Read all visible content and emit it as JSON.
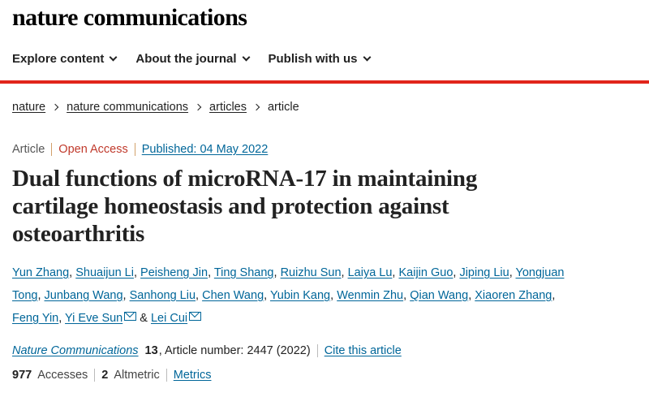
{
  "site": {
    "logo": "nature communications"
  },
  "nav": {
    "items": [
      {
        "label": "Explore content"
      },
      {
        "label": "About the journal"
      },
      {
        "label": "Publish with us"
      }
    ]
  },
  "breadcrumb": {
    "items": [
      "nature",
      "nature communications",
      "articles"
    ],
    "current": "article"
  },
  "meta": {
    "type": "Article",
    "access": "Open Access",
    "published": "Published: 04 May 2022"
  },
  "article": {
    "title": "Dual functions of microRNA-17 in maintaining cartilage homeostasis and protection against osteoarthritis",
    "authors": [
      "Yun Zhang",
      "Shuaijun Li",
      "Peisheng Jin",
      "Ting Shang",
      "Ruizhu Sun",
      "Laiya Lu",
      "Kaijin Guo",
      "Jiping Liu",
      "Yongjuan Tong",
      "Junbang Wang",
      "Sanhong Liu",
      "Chen Wang",
      "Yubin Kang",
      "Wenmin Zhu",
      "Qian Wang",
      "Xiaoren Zhang",
      "Feng Yin",
      "Yi Eve Sun",
      "Lei Cui"
    ],
    "author_joiner": "&"
  },
  "citation": {
    "journal": "Nature Communications",
    "volume": "13",
    "article_number": ", Article number: 2447 (2022)",
    "cite_label": "Cite this article"
  },
  "metrics": {
    "accesses_count": "977",
    "accesses_label": "Accesses",
    "altmetric_count": "2",
    "altmetric_label": "Altmetric",
    "metrics_link": "Metrics"
  },
  "colors": {
    "accent_red": "#e1251b",
    "link_blue": "#006699",
    "open_access": "#c0392b"
  },
  "icons": [
    "chevron-down-icon",
    "chevron-right-icon",
    "mail-icon"
  ]
}
